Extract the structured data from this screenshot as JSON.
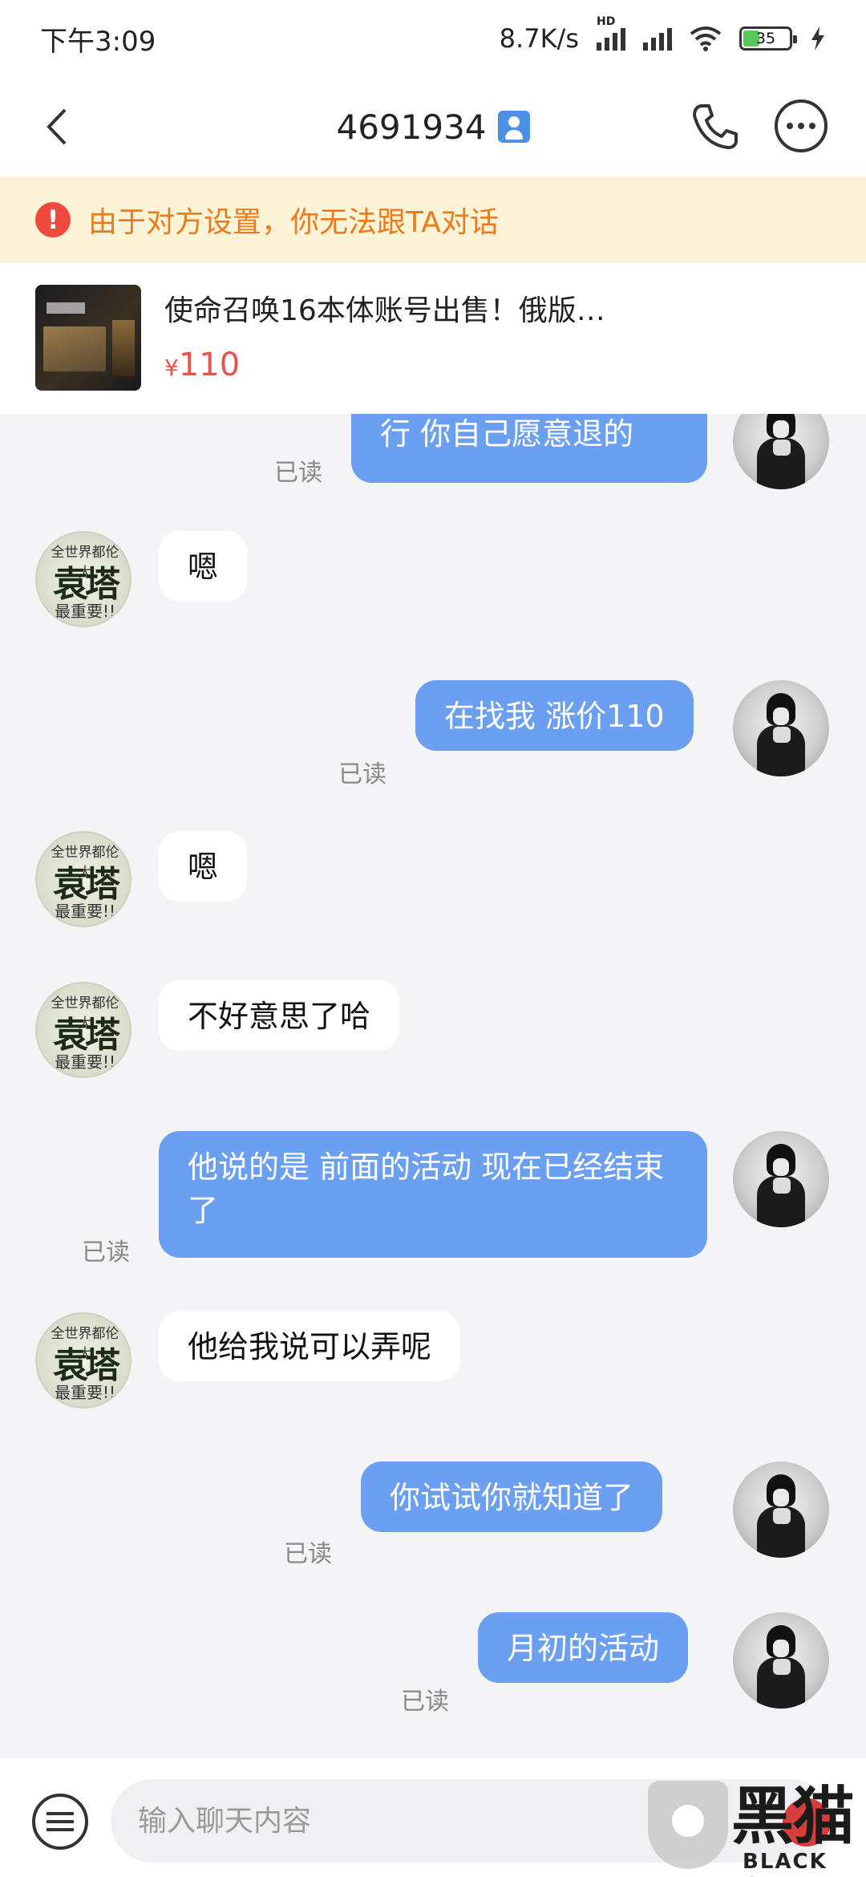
{
  "status_bar": {
    "time": "下午3:09",
    "speed": "8.7K/s",
    "hd_label": "HD",
    "battery_level": 35,
    "battery_text": "35"
  },
  "header": {
    "back_icon": "chevron-left-icon",
    "title": "4691934",
    "contact_icon": "contact-card-icon",
    "phone_icon": "phone-icon",
    "more_icon": "more-dots-icon"
  },
  "warning": {
    "icon": "exclamation-icon",
    "color": "#ec7a1c",
    "text": "由于对方设置，你无法跟TA对话"
  },
  "product": {
    "title": "使命召唤16本体账号出售！俄版…",
    "currency": "¥",
    "price": "110",
    "price_color": "#e8534a"
  },
  "messages": [
    {
      "from": "me",
      "text": "行 你自己愿意退的",
      "read": "已读"
    },
    {
      "from": "other",
      "text": "嗯"
    },
    {
      "from": "me",
      "text": "在找我 涨价110",
      "read": "已读"
    },
    {
      "from": "other",
      "text": "嗯"
    },
    {
      "from": "other",
      "text": "不好意思了哈"
    },
    {
      "from": "me",
      "text": "他说的是 前面的活动 现在已经结束了",
      "read": "已读"
    },
    {
      "from": "other",
      "text": "他给我说可以弄呢"
    },
    {
      "from": "me",
      "text": "你试试你就知道了",
      "read": "已读"
    },
    {
      "from": "me",
      "text": "月初的活动",
      "read": "已读"
    }
  ],
  "other_avatar": {
    "top_text": "全世界都伦大",
    "main_text": "袁塔",
    "bottom_text": "最重要!!"
  },
  "colors": {
    "my_bubble": "#6b9ff2",
    "their_bubble": "#ffffff",
    "background": "#f4f4f6"
  },
  "input": {
    "placeholder": "输入聊天内容",
    "menu_icon": "menu-lines-icon"
  },
  "watermark": {
    "logo_text": "黑猫",
    "brand": "BLACK CAT"
  }
}
